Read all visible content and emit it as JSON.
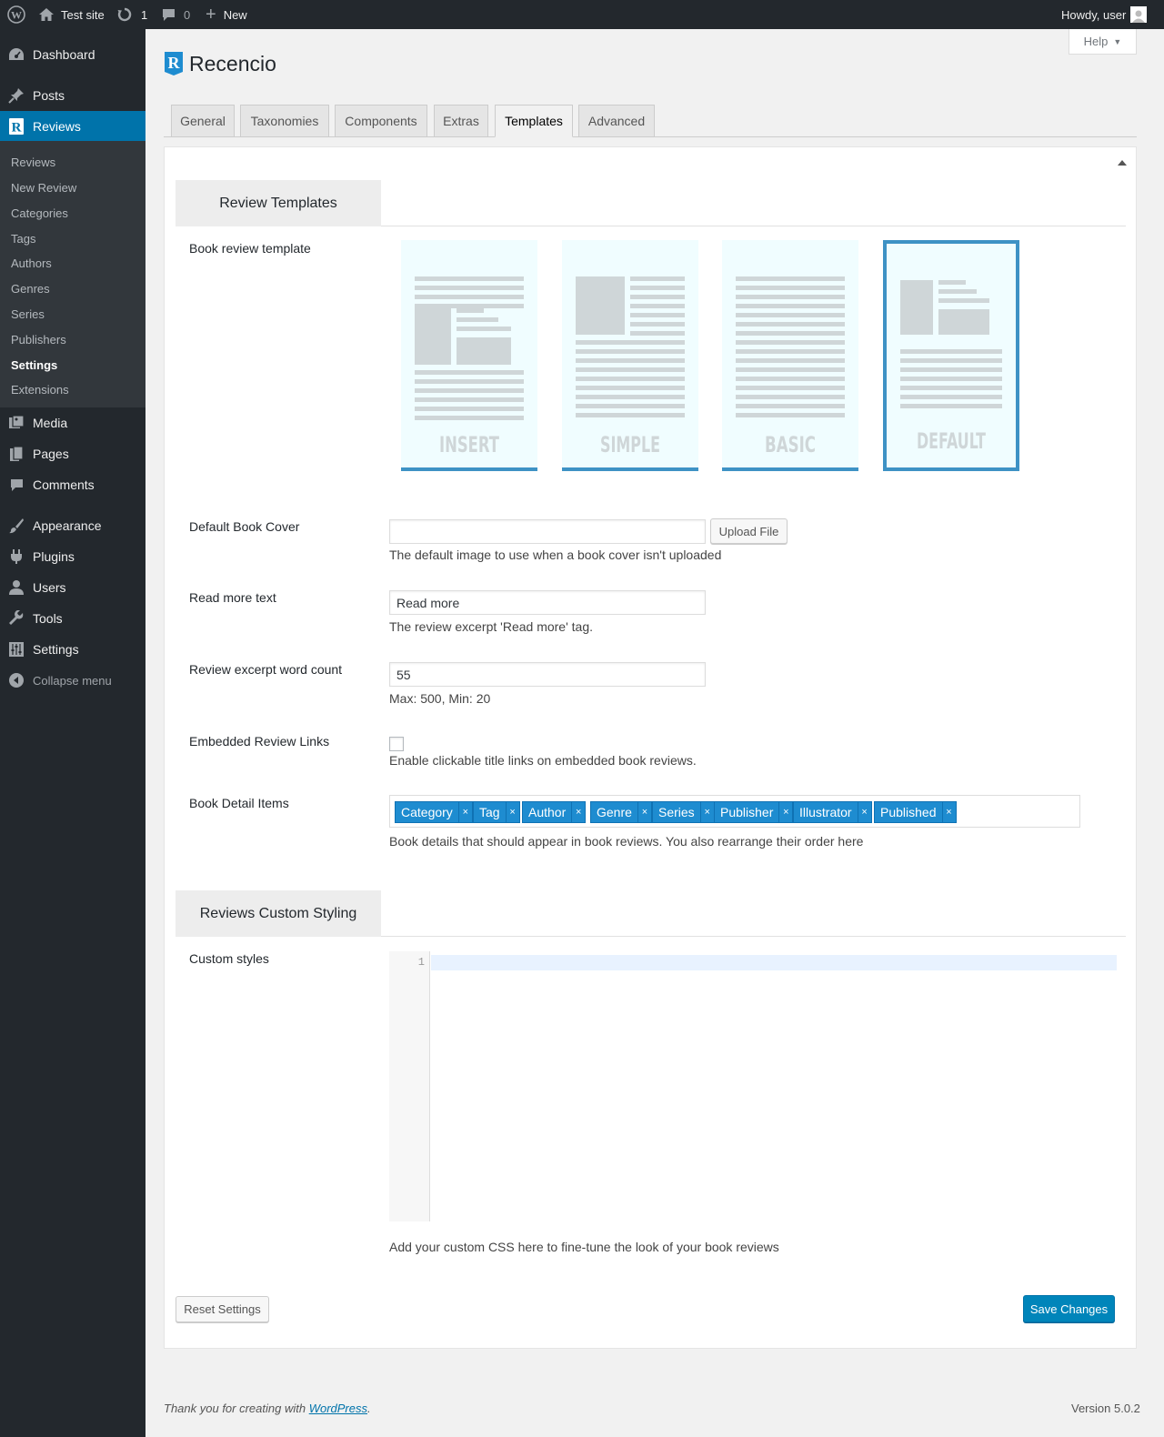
{
  "adminbar": {
    "site_name": "Test site",
    "updates_count": "1",
    "comments_count": "0",
    "new_label": "New",
    "greeting": "Howdy, user"
  },
  "sidebar": {
    "dashboard": "Dashboard",
    "posts": "Posts",
    "reviews": "Reviews",
    "submenu": [
      "Reviews",
      "New Review",
      "Categories",
      "Tags",
      "Authors",
      "Genres",
      "Series",
      "Publishers",
      "Settings",
      "Extensions"
    ],
    "current_submenu": "Settings",
    "media": "Media",
    "pages": "Pages",
    "comments": "Comments",
    "appearance": "Appearance",
    "plugins": "Plugins",
    "users": "Users",
    "tools": "Tools",
    "settings": "Settings",
    "collapse": "Collapse menu"
  },
  "help_label": "Help",
  "brand": {
    "name": "Recencio",
    "logo_letter": "R",
    "color": "#1e8cd0"
  },
  "tabs": [
    "General",
    "Taxonomies",
    "Components",
    "Extras",
    "Templates",
    "Advanced"
  ],
  "active_tab": "Templates",
  "review_templates": {
    "section_title": "Review Templates",
    "book_template_label": "Book review template",
    "templates": [
      "INSERT",
      "SIMPLE",
      "BASIC",
      "DEFAULT"
    ],
    "selected": "DEFAULT",
    "default_cover_label": "Default Book Cover",
    "default_cover_value": "",
    "upload_button": "Upload File",
    "default_cover_desc": "The default image to use when a book cover isn't uploaded",
    "read_more_label": "Read more text",
    "read_more_value": "Read more",
    "read_more_desc": "The review excerpt 'Read more' tag.",
    "excerpt_label": "Review excerpt word count",
    "excerpt_value": "55",
    "excerpt_desc": "Max: 500, Min: 20",
    "embedded_label": "Embedded Review Links",
    "embedded_checked": false,
    "embedded_desc": "Enable clickable title links on embedded book reviews.",
    "detail_items_label": "Book Detail Items",
    "detail_items": [
      "Category",
      "Tag",
      "Author",
      "Genre",
      "Series",
      "Publisher",
      "Illustrator",
      "Published"
    ],
    "chip_remove_glyph": "×",
    "detail_items_desc": "Book details that should appear in book reviews. You also rearrange their order here"
  },
  "custom_styling": {
    "section_title": "Reviews Custom Styling",
    "custom_styles_label": "Custom styles",
    "line_number": "1",
    "desc": "Add your custom CSS here to fine-tune the look of your book reviews"
  },
  "buttons": {
    "reset": "Reset Settings",
    "save": "Save Changes"
  },
  "footer": {
    "thanks_prefix": "Thank you for creating with ",
    "thanks_link": "WordPress",
    "thanks_suffix": ".",
    "version": "Version 5.0.2"
  },
  "colors": {
    "wp_blue": "#0073aa",
    "template_accent": "#3e92c5",
    "chip_blue": "#1e8cd0"
  }
}
